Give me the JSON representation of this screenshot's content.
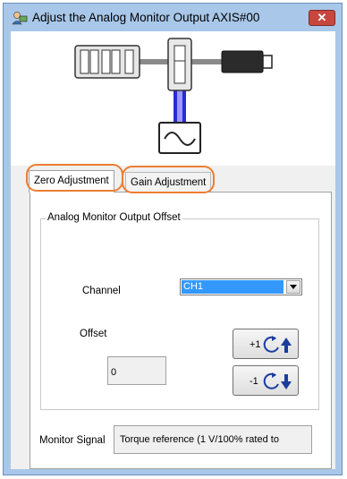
{
  "window": {
    "title": "Adjust the Analog Monitor Output AXIS#00",
    "close_glyph": "✕",
    "title_icon": "monitor-person-icon"
  },
  "diagram": {
    "icons": [
      "controller-unit-icon",
      "servo-amplifier-icon",
      "servo-motor-icon",
      "signal-monitor-icon"
    ],
    "beam_color": "#2b2bd6"
  },
  "tabs": [
    {
      "label": "Zero Adjustment",
      "selected": true
    },
    {
      "label": "Gain Adjustment",
      "selected": false
    }
  ],
  "highlight_color": "#ed7d31",
  "zero_adjustment": {
    "group_label": "Analog Monitor Output Offset",
    "channel_label": "Channel",
    "channel_value": "CH1",
    "offset_label": "Offset",
    "offset_value": "0",
    "plus_label": "+1",
    "minus_label": "-1",
    "monitor_signal_label": "Monitor Signal",
    "monitor_signal_value": "Torque reference (1 V/100% rated to"
  }
}
